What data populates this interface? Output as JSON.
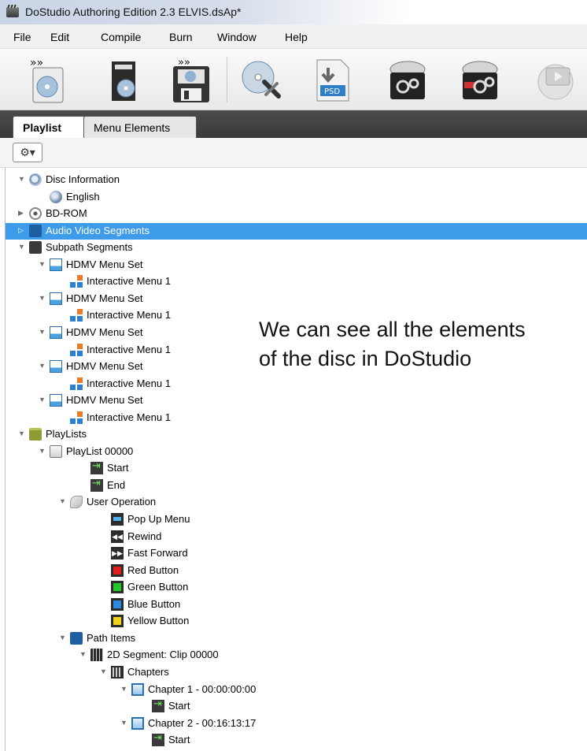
{
  "window": {
    "title": "DoStudio Authoring Edition 2.3 ELVIS.dsAp*"
  },
  "menu": [
    "File",
    "Edit",
    "Compile",
    "Burn",
    "Window",
    "Help"
  ],
  "toolbar": {
    "buttons": [
      "new-disc-icon",
      "open-project-icon",
      "save-project-icon",
      "disc-settings-icon",
      "import-psd-icon",
      "compile-icon",
      "build-icon",
      "preview-icon"
    ],
    "psd_label": "PSD"
  },
  "tabs": {
    "active": "Playlist",
    "inactive": "Menu Elements"
  },
  "options": {
    "gear_label": "⚙▾"
  },
  "tree": [
    {
      "indent": 0,
      "toggle": "▼",
      "icon": "i-discmag",
      "label": "Disc Information"
    },
    {
      "indent": 1,
      "toggle": "",
      "icon": "i-flag",
      "label": "English"
    },
    {
      "indent": 0,
      "toggle": "▶",
      "icon": "i-bdrom",
      "label": "BD-ROM"
    },
    {
      "indent": 0,
      "toggle": "▷",
      "icon": "i-folder-blue",
      "label": "Audio Video Segments",
      "selected": true
    },
    {
      "indent": 0,
      "toggle": "▼",
      "icon": "i-folder-dark",
      "label": "Subpath Segments"
    },
    {
      "indent": 1,
      "toggle": "▼",
      "icon": "i-menuset",
      "label": "HDMV Menu Set"
    },
    {
      "indent": 2,
      "toggle": "",
      "icon": "i-intmenu",
      "label": "Interactive Menu 1"
    },
    {
      "indent": 1,
      "toggle": "▼",
      "icon": "i-menuset",
      "label": "HDMV Menu Set"
    },
    {
      "indent": 2,
      "toggle": "",
      "icon": "i-intmenu",
      "label": "Interactive Menu 1"
    },
    {
      "indent": 1,
      "toggle": "▼",
      "icon": "i-menuset",
      "label": "HDMV Menu Set"
    },
    {
      "indent": 2,
      "toggle": "",
      "icon": "i-intmenu",
      "label": "Interactive Menu 1"
    },
    {
      "indent": 1,
      "toggle": "▼",
      "icon": "i-menuset",
      "label": "HDMV Menu Set"
    },
    {
      "indent": 2,
      "toggle": "",
      "icon": "i-intmenu",
      "label": "Interactive Menu 1"
    },
    {
      "indent": 1,
      "toggle": "▼",
      "icon": "i-menuset",
      "label": "HDMV Menu Set"
    },
    {
      "indent": 2,
      "toggle": "",
      "icon": "i-intmenu",
      "label": "Interactive Menu 1"
    },
    {
      "indent": 0,
      "toggle": "▼",
      "icon": "i-folder-olive",
      "label": "PlayLists"
    },
    {
      "indent": 1,
      "toggle": "▼",
      "icon": "i-playlist",
      "label": "PlayList 00000"
    },
    {
      "indent": 3,
      "toggle": "",
      "icon": "i-start",
      "label": "Start"
    },
    {
      "indent": 3,
      "toggle": "",
      "icon": "i-end",
      "label": "End"
    },
    {
      "indent": 2,
      "toggle": "▼",
      "icon": "i-userop",
      "label": "User Operation"
    },
    {
      "indent": 4,
      "toggle": "",
      "icon": "i-popup",
      "label": "Pop Up Menu"
    },
    {
      "indent": 4,
      "toggle": "",
      "icon": "i-rewind",
      "label": "Rewind"
    },
    {
      "indent": 4,
      "toggle": "",
      "icon": "i-ff",
      "label": "Fast Forward"
    },
    {
      "indent": 4,
      "toggle": "",
      "icon": "i-red",
      "label": "Red Button"
    },
    {
      "indent": 4,
      "toggle": "",
      "icon": "i-green",
      "label": "Green Button"
    },
    {
      "indent": 4,
      "toggle": "",
      "icon": "i-blue",
      "label": "Blue Button"
    },
    {
      "indent": 4,
      "toggle": "",
      "icon": "i-yellow",
      "label": "Yellow Button"
    },
    {
      "indent": 2,
      "toggle": "▼",
      "icon": "i-folder-blue",
      "label": "Path Items"
    },
    {
      "indent": 3,
      "toggle": "▼",
      "icon": "i-segment",
      "label": "2D Segment: Clip 00000"
    },
    {
      "indent": 4,
      "toggle": "▼",
      "icon": "i-chapters",
      "label": "Chapters"
    },
    {
      "indent": 5,
      "toggle": "▼",
      "icon": "i-chapter",
      "label": "Chapter 1 - 00:00:00:00"
    },
    {
      "indent": 6,
      "toggle": "",
      "icon": "i-start",
      "label": "Start"
    },
    {
      "indent": 5,
      "toggle": "▼",
      "icon": "i-chapter",
      "label": "Chapter 2 - 00:16:13:17"
    },
    {
      "indent": 6,
      "toggle": "",
      "icon": "i-start",
      "label": "Start"
    }
  ],
  "annotation": {
    "line1": "We can see all the elements",
    "line2": "of the disc in DoStudio"
  }
}
